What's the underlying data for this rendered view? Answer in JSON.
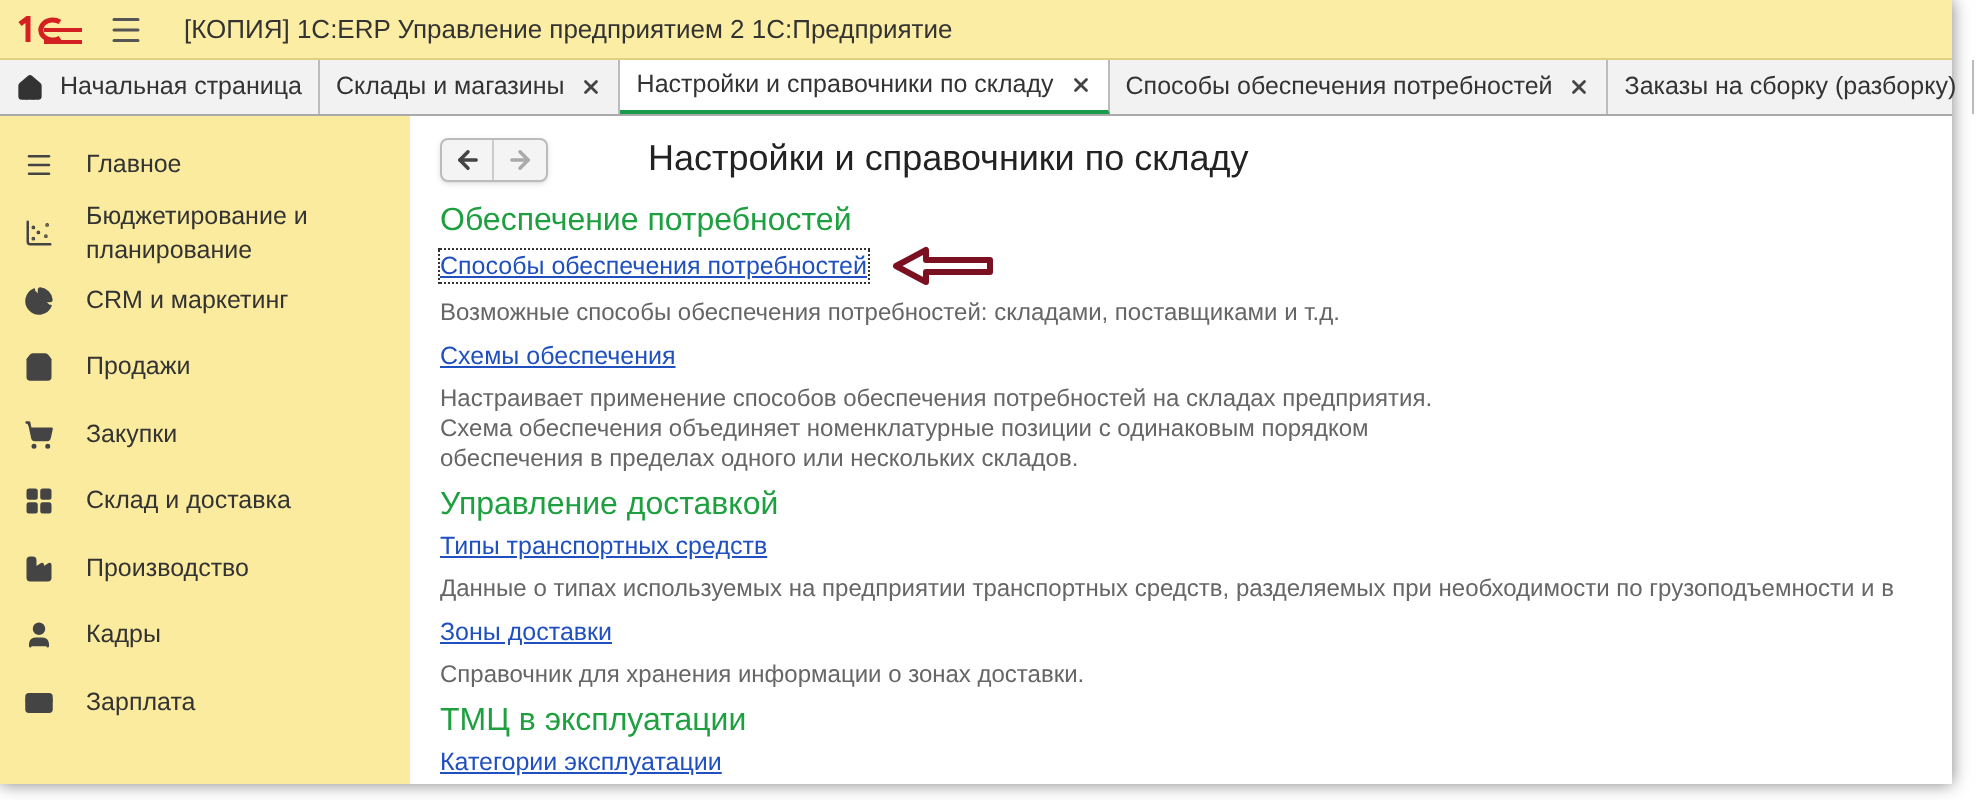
{
  "window": {
    "title": "[КОПИЯ] 1С:ERP Управление предприятием 2 1С:Предприятие"
  },
  "tabs": [
    {
      "label": "Начальная страница",
      "kind": "home",
      "closable": false,
      "selected": false
    },
    {
      "label": "Склады и магазины",
      "kind": "page",
      "closable": true,
      "selected": false
    },
    {
      "label": "Настройки и справочники по складу",
      "kind": "page",
      "closable": true,
      "selected": true
    },
    {
      "label": "Способы обеспечения потребностей",
      "kind": "page",
      "closable": true,
      "selected": false
    },
    {
      "label": "Заказы на сборку (разборку)",
      "kind": "page",
      "closable": false,
      "selected": false
    }
  ],
  "sidebar": {
    "items": [
      {
        "label": "Главное",
        "kind": "menu"
      },
      {
        "label": "Бюджетирование и планирование",
        "kind": "budget"
      },
      {
        "label": "CRM и маркетинг",
        "kind": "crm"
      },
      {
        "label": "Продажи",
        "kind": "sales"
      },
      {
        "label": "Закупки",
        "kind": "purchases"
      },
      {
        "label": "Склад и доставка",
        "kind": "warehouse"
      },
      {
        "label": "Производство",
        "kind": "production"
      },
      {
        "label": "Кадры",
        "kind": "staff"
      },
      {
        "label": "Зарплата",
        "kind": "salary"
      }
    ]
  },
  "navigation": {
    "back": {
      "disabled": false
    },
    "forward": {
      "disabled": true
    }
  },
  "page": {
    "title": "Настройки и справочники по складу",
    "sections": [
      {
        "title": "Обеспечение потребностей",
        "items": [
          {
            "link": "Способы обеспечения потребностей",
            "focused": true,
            "pointed": true,
            "description": [
              "Возможные способы обеспечения потребностей: складами, поставщиками и т.д."
            ]
          },
          {
            "link": "Схемы обеспечения",
            "focused": false,
            "pointed": false,
            "description": [
              "Настраивает применение способов обеспечения потребностей на складах предприятия.",
              "Схема обеспечения объединяет номенклатурные позиции с одинаковым порядком",
              "обеспечения в пределах одного или нескольких складов."
            ]
          }
        ]
      },
      {
        "title": "Управление доставкой",
        "items": [
          {
            "link": "Типы транспортных средств",
            "focused": false,
            "pointed": false,
            "description": [
              "Данные о типах используемых на предприятии транспортных средств, разделяемых при необходимости по грузоподъемности и в"
            ]
          },
          {
            "link": "Зоны доставки",
            "focused": false,
            "pointed": false,
            "description": [
              "Справочник для хранения информации о зонах доставки."
            ]
          }
        ]
      },
      {
        "title": "ТМЦ в эксплуатации",
        "items": [
          {
            "link": "Категории эксплуатации",
            "focused": false,
            "pointed": false
          }
        ]
      }
    ]
  }
}
